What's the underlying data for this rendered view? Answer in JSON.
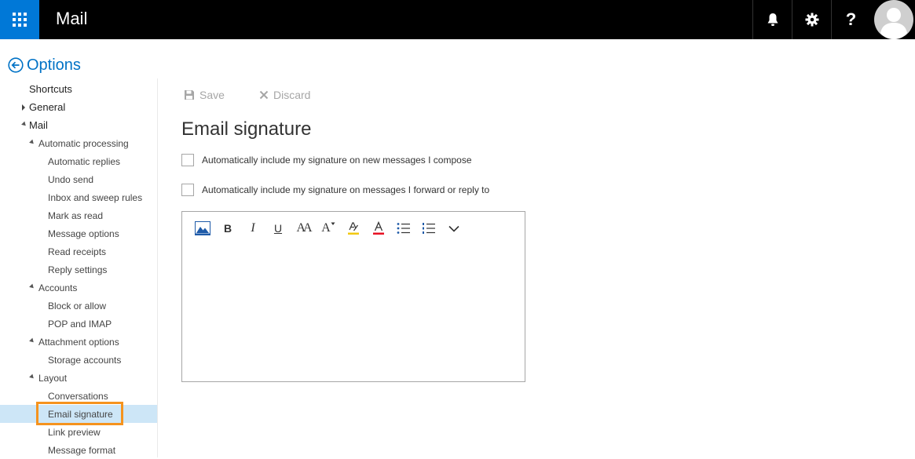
{
  "app": {
    "title": "Mail"
  },
  "header": {
    "waffle_icon": "app-launcher-icon",
    "notifications_icon": "bell-icon",
    "settings_icon": "gear-icon",
    "help_label": "?",
    "avatar_icon": "user-avatar-icon"
  },
  "nav": {
    "options_label": "Options",
    "items": [
      {
        "label": "Shortcuts",
        "level": 0,
        "caret": "none"
      },
      {
        "label": "General",
        "level": 0,
        "caret": "right"
      },
      {
        "label": "Mail",
        "level": 0,
        "caret": "down"
      },
      {
        "label": "Automatic processing",
        "level": 1,
        "caret": "down"
      },
      {
        "label": "Automatic replies",
        "level": 2,
        "caret": "none"
      },
      {
        "label": "Undo send",
        "level": 2,
        "caret": "none"
      },
      {
        "label": "Inbox and sweep rules",
        "level": 2,
        "caret": "none"
      },
      {
        "label": "Mark as read",
        "level": 2,
        "caret": "none"
      },
      {
        "label": "Message options",
        "level": 2,
        "caret": "none"
      },
      {
        "label": "Read receipts",
        "level": 2,
        "caret": "none"
      },
      {
        "label": "Reply settings",
        "level": 2,
        "caret": "none"
      },
      {
        "label": "Accounts",
        "level": 1,
        "caret": "down"
      },
      {
        "label": "Block or allow",
        "level": 2,
        "caret": "none"
      },
      {
        "label": "POP and IMAP",
        "level": 2,
        "caret": "none"
      },
      {
        "label": "Attachment options",
        "level": 1,
        "caret": "down"
      },
      {
        "label": "Storage accounts",
        "level": 2,
        "caret": "none"
      },
      {
        "label": "Layout",
        "level": 1,
        "caret": "down"
      },
      {
        "label": "Conversations",
        "level": 2,
        "caret": "none"
      },
      {
        "label": "Email signature",
        "level": 2,
        "caret": "none",
        "selected": true
      },
      {
        "label": "Link preview",
        "level": 2,
        "caret": "none"
      },
      {
        "label": "Message format",
        "level": 2,
        "caret": "none"
      }
    ]
  },
  "toolbar": {
    "save_label": "Save",
    "discard_label": "Discard"
  },
  "main": {
    "title": "Email signature",
    "check_new": {
      "label": "Automatically include my signature on new messages I compose",
      "checked": false
    },
    "check_reply": {
      "label": "Automatically include my signature on messages I forward or reply to",
      "checked": false
    },
    "editor": {
      "body": "",
      "tools": [
        {
          "name": "insert-picture-icon",
          "glyph": ""
        },
        {
          "name": "bold-icon",
          "glyph": "B"
        },
        {
          "name": "italic-icon",
          "glyph": "I"
        },
        {
          "name": "underline-icon",
          "glyph": "U"
        },
        {
          "name": "font-size-icon",
          "glyph": "AA"
        },
        {
          "name": "text-style-icon",
          "glyph": "A"
        },
        {
          "name": "highlight-icon",
          "glyph": ""
        },
        {
          "name": "font-color-icon",
          "glyph": "A"
        },
        {
          "name": "bullet-list-icon",
          "glyph": ""
        },
        {
          "name": "numbered-list-icon",
          "glyph": ""
        },
        {
          "name": "more-options-icon",
          "glyph": ""
        }
      ]
    }
  },
  "colors": {
    "accent": "#0078d7",
    "link": "#0072c6",
    "topbar": "#000000",
    "selected_bg": "#cde6f7",
    "highlight_outline": "#f5931e",
    "highlight_ink": "#f2c811",
    "font_color_ink": "#e81123"
  }
}
